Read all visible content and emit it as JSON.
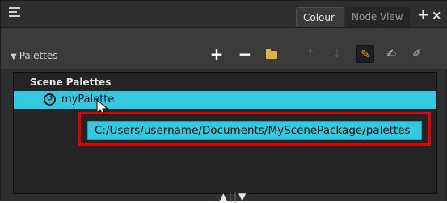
{
  "tabs": {
    "menu_icon": "hamburger-icon",
    "colour": "Colour",
    "node_view": "Node View",
    "add_symbol": "+",
    "close_symbol": "×"
  },
  "toolbar": {
    "palettes_label": "Palettes",
    "collapse_symbol": "▼",
    "add_symbol": "+",
    "remove_symbol": "−",
    "up_symbol": "↑",
    "down_symbol": "↓",
    "active_symbol": "✎",
    "brush_symbol": "✍",
    "brush2_symbol": "✐"
  },
  "list": {
    "header": "Scene Palettes",
    "items": [
      {
        "label": "myPalette",
        "selected": true,
        "icon": "palette-link-icon"
      }
    ]
  },
  "tooltip": {
    "text": "C:/Users/username/Documents/MyScenePackage/palettes"
  },
  "splitter": {
    "up_symbol": "▲",
    "divider": "||",
    "down_symbol": "▼"
  },
  "colors": {
    "accent": "#36c8e0",
    "highlight_outline": "#e00000",
    "folder": "#e0b24a",
    "background": "#2e2e2e"
  }
}
